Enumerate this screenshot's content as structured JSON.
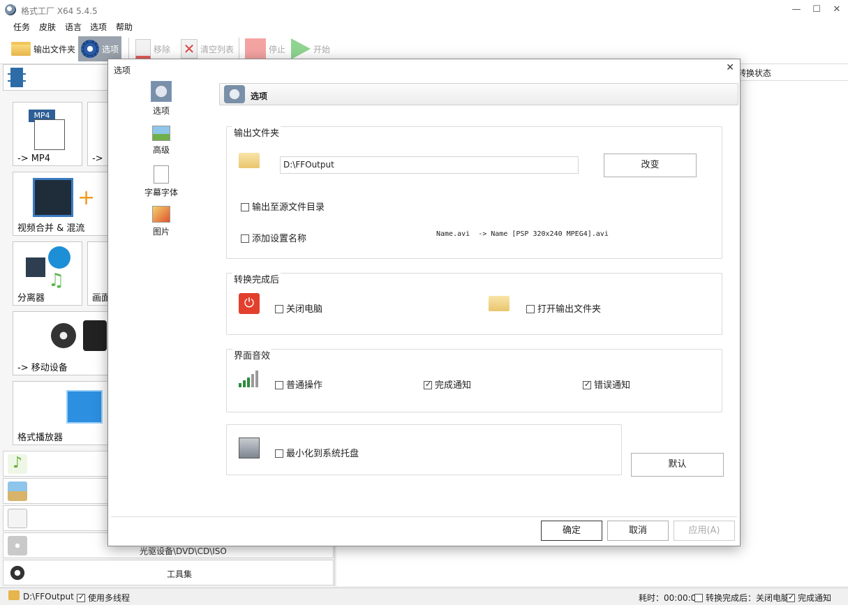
{
  "window": {
    "title": "格式工厂 X64 5.4.5",
    "controls": [
      "—",
      "☐",
      "✕"
    ]
  },
  "menu": [
    "任务",
    "皮肤",
    "语言",
    "选项",
    "帮助"
  ],
  "toolbar": {
    "output_folder": "输出文件夹",
    "options": "选项",
    "remove": "移除",
    "clear_list": "清空列表",
    "stop": "停止",
    "start": "开始"
  },
  "left": {
    "tiles": {
      "mp4": "-> MP4",
      "mp4_badge": "MP4",
      "mp4_partial": "->",
      "merge": "视频合并 & 混流",
      "splitter": "分离器",
      "screen_partial": "画面",
      "mobile": "-> 移动设备",
      "player": "格式播放器"
    },
    "categories": {
      "optical": "光驱设备\\DVD\\CD\\ISO",
      "tools": "工具集"
    }
  },
  "right": {
    "status_header": "转换状态"
  },
  "statusbar": {
    "output_path": "D:\\FFOutput",
    "multithread": "使用多线程",
    "elapsed": "耗时：00:00:00",
    "after_convert": "转换完成后：关闭电脑",
    "complete_notify": "完成通知"
  },
  "dialog": {
    "title": "选项",
    "nav": [
      "选项",
      "高级",
      "字幕字体",
      "图片"
    ],
    "header": "选项",
    "output_group": {
      "title": "输出文件夹",
      "path": "D:\\FFOutput",
      "change": "改变",
      "to_source_dir": "输出至源文件目录",
      "add_setting_name": "添加设置名称",
      "name_example": "Name.avi  -> Name [PSP 320x240 MPEG4].avi"
    },
    "after_group": {
      "title": "转换完成后",
      "shutdown": "关闭电脑",
      "open_output": "打开输出文件夹"
    },
    "sound_group": {
      "title": "界面音效",
      "normal_op": "普通操作",
      "complete_notify": "完成通知",
      "error_notify": "错误通知"
    },
    "tray": {
      "minimize": "最小化到系统托盘",
      "default": "默认"
    },
    "buttons": {
      "ok": "确定",
      "cancel": "取消",
      "apply": "应用(A)"
    }
  }
}
